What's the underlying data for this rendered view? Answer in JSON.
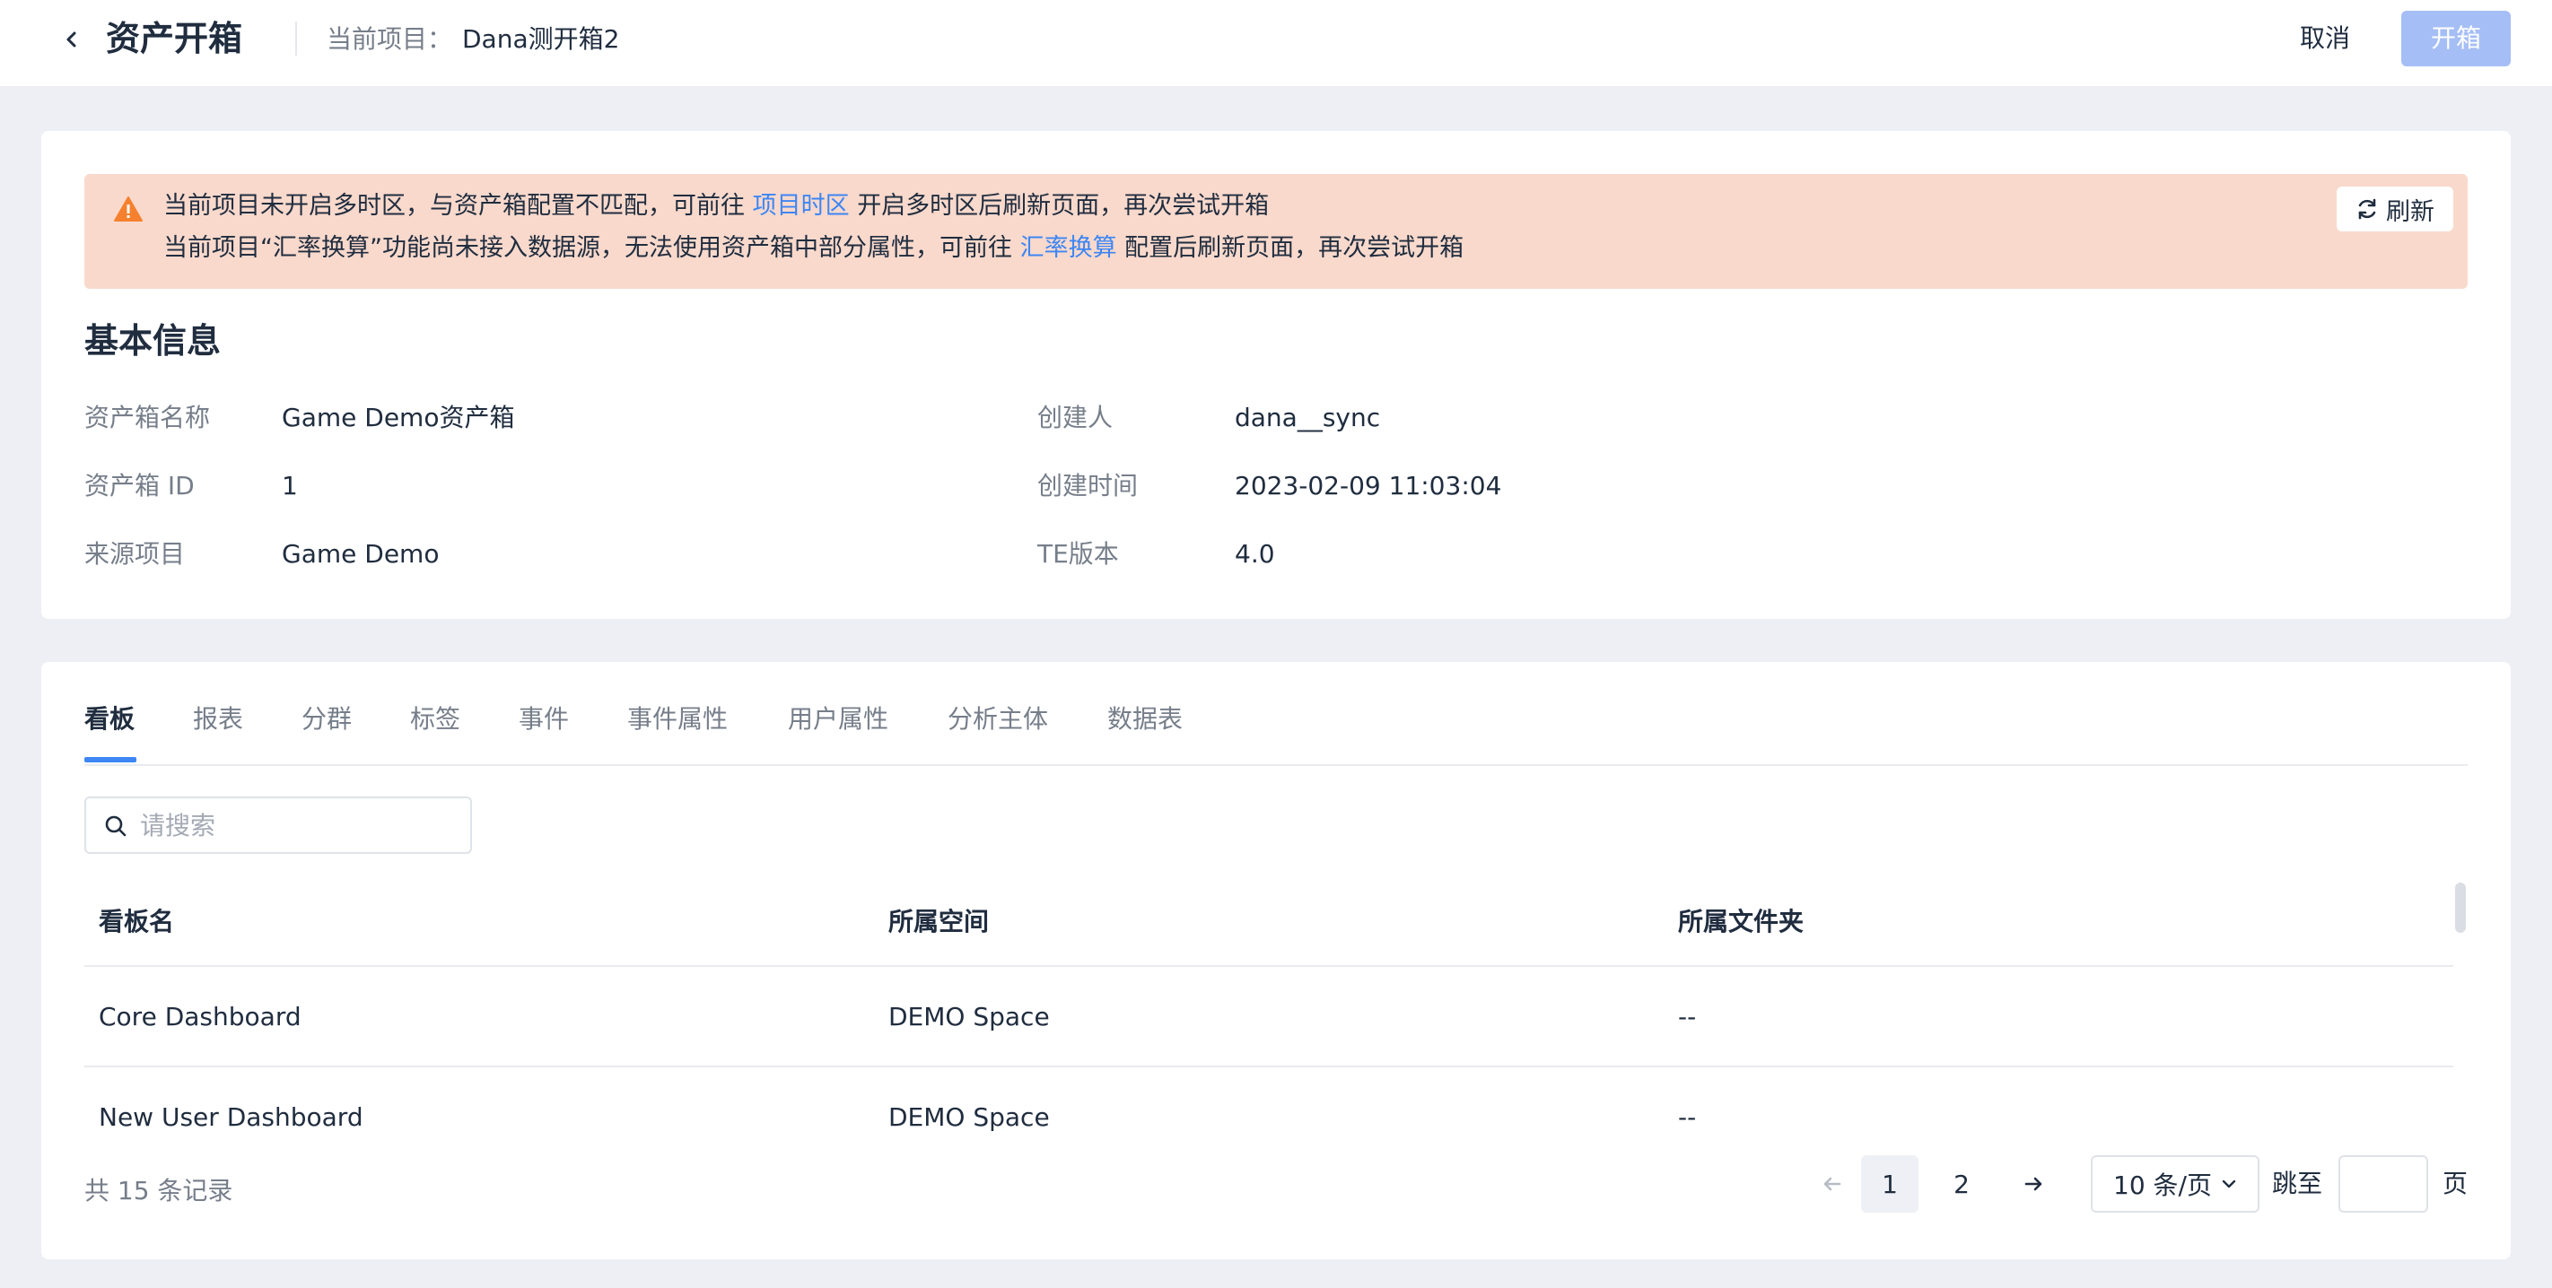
{
  "header": {
    "title": "资产开箱",
    "project_label": "当前项目：",
    "project_name": "Dana测开箱2",
    "cancel_label": "取消",
    "open_label": "开箱"
  },
  "alert": {
    "line1_prefix": "当前项目未开启多时区，与资产箱配置不匹配，可前往",
    "line1_link": "项目时区",
    "line1_suffix": "开启多时区后刷新页面，再次尝试开箱",
    "line2_prefix": "当前项目“汇率换算”功能尚未接入数据源，无法使用资产箱中部分属性，可前往",
    "line2_link": "汇率换算",
    "line2_suffix": "配置后刷新页面，再次尝试开箱",
    "refresh_label": "刷新"
  },
  "basic_info": {
    "title": "基本信息",
    "name_label": "资产箱名称",
    "name_value": "Game Demo资产箱",
    "id_label": "资产箱 ID",
    "id_value": "1",
    "source_label": "来源项目",
    "source_value": "Game Demo",
    "creator_label": "创建人",
    "creator_value": "dana__sync",
    "created_time_label": "创建时间",
    "created_time_value": "2023-02-09 11:03:04",
    "te_version_label": "TE版本",
    "te_version_value": "4.0"
  },
  "tabs": [
    "看板",
    "报表",
    "分群",
    "标签",
    "事件",
    "事件属性",
    "用户属性",
    "分析主体",
    "数据表"
  ],
  "active_tab": "看板",
  "search": {
    "placeholder": "请搜索"
  },
  "table": {
    "headers": [
      "看板名",
      "所属空间",
      "所属文件夹"
    ],
    "rows": [
      [
        "Core Dashboard",
        "DEMO Space",
        "--"
      ],
      [
        "New User Dashboard",
        "DEMO Space",
        "--"
      ]
    ]
  },
  "pagination": {
    "total_text": "共 15 条记录",
    "pages": [
      "1",
      "2"
    ],
    "current_page": "1",
    "page_size": "10 条/页",
    "jump_label": "跳至",
    "page_unit": "页"
  },
  "colors": {
    "accent": "#3d86f4",
    "alert_bg": "#f9d9cc",
    "warning_icon": "#f5812f",
    "primary_disabled": "#a5bef6"
  }
}
